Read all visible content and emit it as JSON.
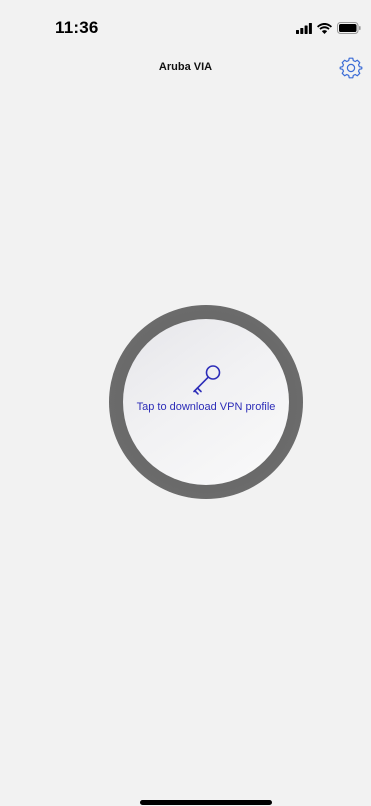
{
  "status_bar": {
    "time": "11:36",
    "icons": [
      "cellular-signal-icon",
      "wifi-icon",
      "battery-icon"
    ]
  },
  "nav": {
    "title": "Aruba VIA",
    "settings_icon": "gear-icon"
  },
  "vpn_button": {
    "icon": "key-icon",
    "label": "Tap to download VPN profile"
  },
  "colors": {
    "background": "#f2f2f2",
    "accent": "#2d2db8",
    "settings_icon": "#3a6bd6"
  }
}
